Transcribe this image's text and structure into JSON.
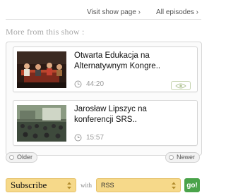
{
  "header": {
    "visit_show": "Visit show page ›",
    "all_episodes": "All episodes ›"
  },
  "section": {
    "title": "More from this show :"
  },
  "episodes": [
    {
      "title": "Otwarta Edukacja na Alternatywnym Kongre..",
      "duration": "44:20",
      "icon": "clock-icon"
    },
    {
      "title": "Jarosław Lipszyc na konferencji SRS..",
      "duration": "15:57",
      "icon": "clock-icon"
    }
  ],
  "pager": {
    "older": "Older",
    "newer": "Newer"
  },
  "subscribe": {
    "label": "Subscribe",
    "with": "with",
    "format": "RSS",
    "go": "go!"
  },
  "colors": {
    "accent": "#f6d98a",
    "go": "#4aa34a",
    "eye_border": "#c6d4b0"
  }
}
